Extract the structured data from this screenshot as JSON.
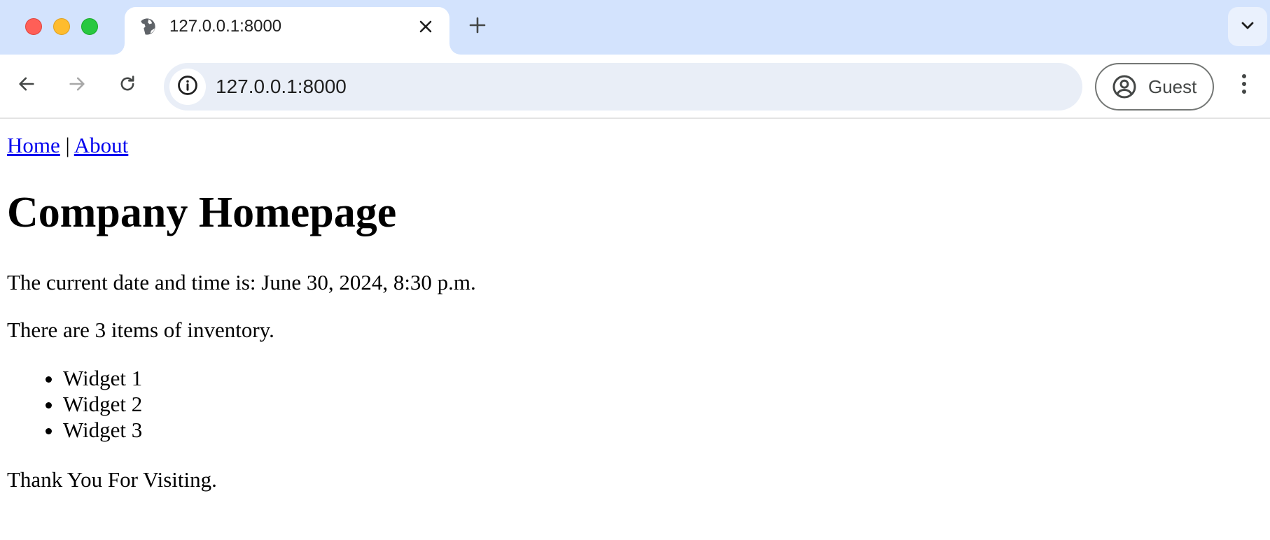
{
  "browser": {
    "tab": {
      "title": "127.0.0.1:8000",
      "favicon": "globe-icon",
      "close_icon": "close-icon"
    },
    "new_tab_icon": "plus-icon",
    "tab_search_icon": "chevron-down-icon",
    "nav": {
      "back_icon": "arrow-left-icon",
      "forward_icon": "arrow-right-icon",
      "reload_icon": "reload-icon"
    },
    "address_bar": {
      "url": "127.0.0.1:8000",
      "site_info_icon": "info-icon"
    },
    "profile": {
      "label": "Guest",
      "icon": "account-circle-icon"
    },
    "menu_icon": "more-vert-icon",
    "colors": {
      "tabbar_bg": "#d3e3fd",
      "omnibox_bg": "#e9eef7",
      "link": "#0000ee"
    }
  },
  "page": {
    "nav_links": [
      {
        "label": "Home"
      },
      {
        "label": "About"
      }
    ],
    "nav_separator": "|",
    "title": "Company Homepage",
    "datetime_text": "The current date and time is: June 30, 2024, 8:30 p.m.",
    "inventory_text": "There are 3 items of inventory.",
    "inventory_items": [
      "Widget 1",
      "Widget 2",
      "Widget 3"
    ],
    "footer_text": "Thank You For Visiting."
  }
}
